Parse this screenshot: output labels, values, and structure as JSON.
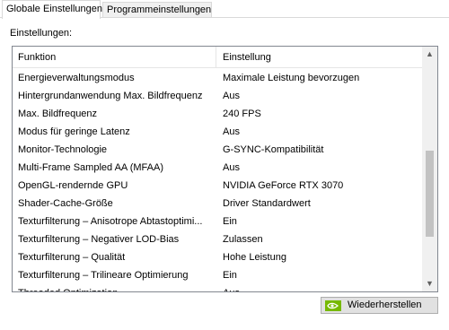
{
  "tabs": [
    {
      "label": "Globale Einstellungen",
      "active": true
    },
    {
      "label": "Programmeinstellungen",
      "active": false
    }
  ],
  "section_label": "Einstellungen:",
  "table": {
    "columns": [
      "Funktion",
      "Einstellung"
    ],
    "rows": [
      {
        "feature": "Energieverwaltungsmodus",
        "value": "Maximale Leistung bevorzugen"
      },
      {
        "feature": "Hintergrundanwendung Max. Bildfrequenz",
        "value": "Aus"
      },
      {
        "feature": "Max. Bildfrequenz",
        "value": "240 FPS"
      },
      {
        "feature": "Modus für geringe Latenz",
        "value": "Aus"
      },
      {
        "feature": "Monitor-Technologie",
        "value": "G-SYNC-Kompatibilität"
      },
      {
        "feature": "Multi-Frame Sampled AA (MFAA)",
        "value": "Aus"
      },
      {
        "feature": "OpenGL-rendernde GPU",
        "value": "NVIDIA GeForce RTX 3070"
      },
      {
        "feature": "Shader-Cache-Größe",
        "value": "Driver Standardwert"
      },
      {
        "feature": "Texturfilterung – Anisotrope Abtastoptimi...",
        "value": "Ein"
      },
      {
        "feature": "Texturfilterung – Negativer LOD-Bias",
        "value": "Zulassen"
      },
      {
        "feature": "Texturfilterung – Qualität",
        "value": "Hohe Leistung"
      },
      {
        "feature": "Texturfilterung – Trilineare Optimierung",
        "value": "Ein"
      },
      {
        "feature": "Threaded Optimization",
        "value": "Aus"
      }
    ]
  },
  "restore_button": {
    "label": "Wiederherstellen",
    "icon": "nvidia-logo-icon"
  },
  "colors": {
    "nvidia_green": "#76b900",
    "border": "#828790",
    "scroll_thumb": "#c2c2c2"
  }
}
